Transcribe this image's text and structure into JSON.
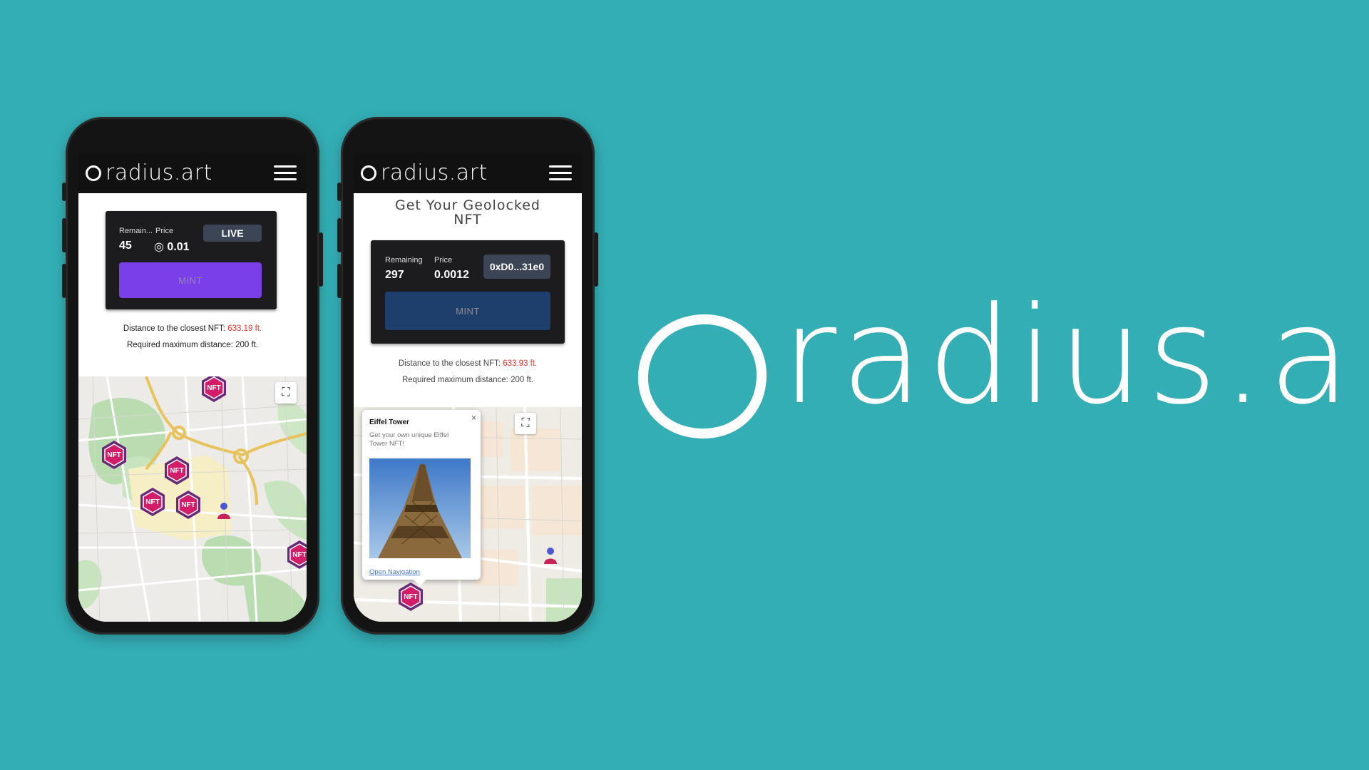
{
  "brand": {
    "name": "radius.art"
  },
  "phone1": {
    "nav_brand": "radius.art",
    "card": {
      "remaining_label": "Remain...",
      "price_label": "Price",
      "remaining_value": "45",
      "price_value": "◎ 0.01",
      "status": "LIVE",
      "mint_label": "MINT"
    },
    "distance_prefix": "Distance to the closest NFT: ",
    "distance_value": "633.19 ft.",
    "required_text": "Required maximum distance: 200 ft.",
    "marker_label": "NFT"
  },
  "phone2": {
    "nav_brand": "radius.art",
    "heading_line1": "Get Your Geolocked",
    "heading_line2": "NFT",
    "card": {
      "remaining_label": "Remaining",
      "price_label": "Price",
      "remaining_value": "297",
      "price_value": "0.0012",
      "wallet": "0xD0...31e0",
      "mint_label": "MINT"
    },
    "distance_prefix": "Distance to the closest NFT: ",
    "distance_value": "633.93 ft.",
    "required_text": "Required maximum distance: 200 ft.",
    "popup": {
      "title": "Eiffel Tower",
      "close": "×",
      "description": "Get your own unique Eiffel Tower NFT!",
      "link": "Open Navigation"
    },
    "marker_label": "NFT"
  },
  "colors": {
    "background": "#33aeb5",
    "mint_purple": "#7a3fe8",
    "mint_blue": "#1e3e6c",
    "distance_red": "#e6382f",
    "marker_pink": "#c81b6a"
  },
  "icons": [
    "hamburger-menu-icon",
    "fullscreen-icon",
    "nft-marker-icon",
    "user-location-icon",
    "close-icon",
    "radius-ring-logo"
  ]
}
